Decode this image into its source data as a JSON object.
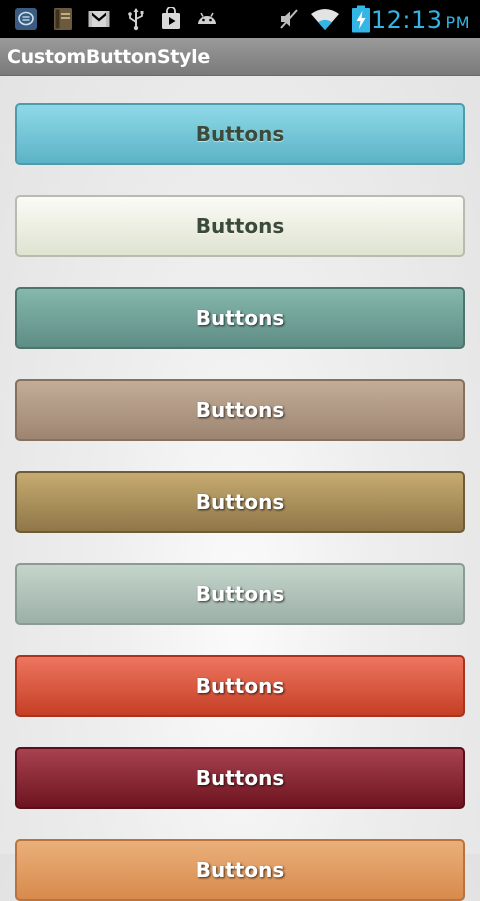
{
  "status_bar": {
    "time": "12:13",
    "ampm": "PM",
    "icons": [
      "messenger-icon",
      "book-icon",
      "gmail-icon",
      "usb-icon",
      "play-store-icon",
      "android-debug-icon",
      "mute-icon",
      "wifi-icon",
      "battery-charging-icon"
    ],
    "clock_color": "#33b5e5"
  },
  "app": {
    "title": "CustomButtonStyle"
  },
  "buttons": [
    {
      "label": "Buttons",
      "color": "#7dcfe0"
    },
    {
      "label": "Buttons",
      "color": "#eef0e6"
    },
    {
      "label": "Buttons",
      "color": "#74a59b"
    },
    {
      "label": "Buttons",
      "color": "#b09a86"
    },
    {
      "label": "Buttons",
      "color": "#aa915c"
    },
    {
      "label": "Buttons",
      "color": "#b3c5bc"
    },
    {
      "label": "Buttons",
      "color": "#dd5a41"
    },
    {
      "label": "Buttons",
      "color": "#8a2b37"
    },
    {
      "label": "Buttons",
      "color": "#e6a268"
    }
  ]
}
